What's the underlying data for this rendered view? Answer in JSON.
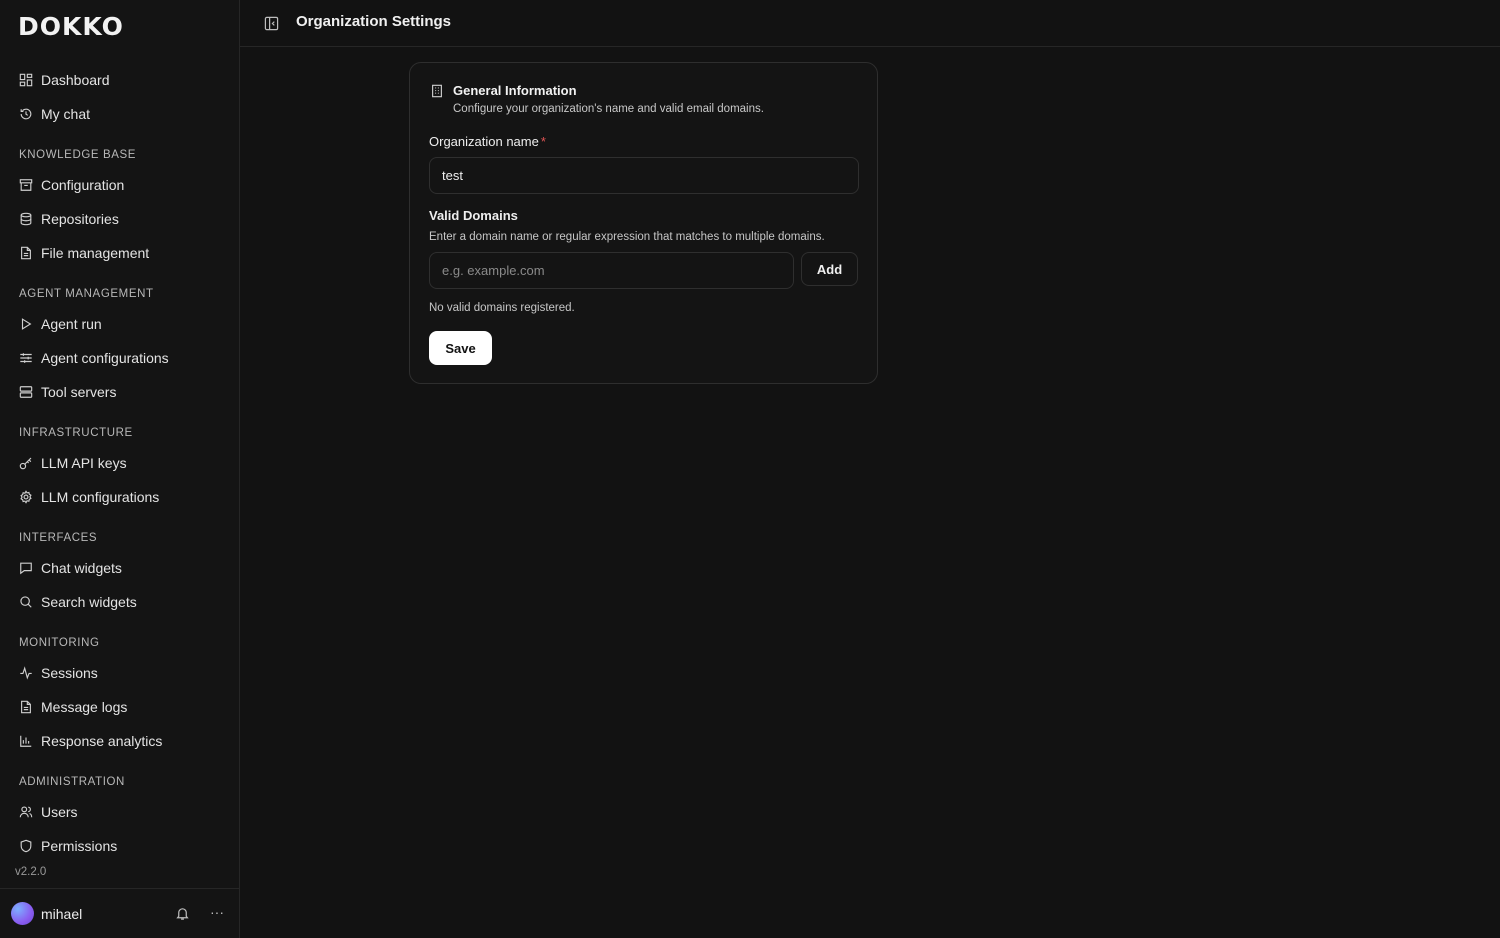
{
  "app": {
    "logo": "DOKKO",
    "version": "v2.2.0"
  },
  "sidebar": {
    "top_items": [
      {
        "label": "Dashboard",
        "icon": "dashboard-icon"
      },
      {
        "label": "My chat",
        "icon": "history-icon"
      }
    ],
    "sections": [
      {
        "title": "KNOWLEDGE BASE",
        "items": [
          {
            "label": "Configuration",
            "icon": "archive-icon"
          },
          {
            "label": "Repositories",
            "icon": "database-icon"
          },
          {
            "label": "File management",
            "icon": "file-icon"
          }
        ]
      },
      {
        "title": "AGENT MANAGEMENT",
        "items": [
          {
            "label": "Agent run",
            "icon": "play-icon"
          },
          {
            "label": "Agent configurations",
            "icon": "sliders-icon"
          },
          {
            "label": "Tool servers",
            "icon": "server-icon"
          }
        ]
      },
      {
        "title": "INFRASTRUCTURE",
        "items": [
          {
            "label": "LLM API keys",
            "icon": "key-icon"
          },
          {
            "label": "LLM configurations",
            "icon": "gear-icon"
          }
        ]
      },
      {
        "title": "INTERFACES",
        "items": [
          {
            "label": "Chat widgets",
            "icon": "chat-icon"
          },
          {
            "label": "Search widgets",
            "icon": "search-icon"
          }
        ]
      },
      {
        "title": "MONITORING",
        "items": [
          {
            "label": "Sessions",
            "icon": "activity-icon"
          },
          {
            "label": "Message logs",
            "icon": "file-icon"
          },
          {
            "label": "Response analytics",
            "icon": "bar-chart-icon"
          }
        ]
      },
      {
        "title": "ADMINISTRATION",
        "items": [
          {
            "label": "Users",
            "icon": "users-icon"
          },
          {
            "label": "Permissions",
            "icon": "shield-icon"
          }
        ]
      }
    ],
    "user": {
      "name": "mihael"
    }
  },
  "header": {
    "title": "Organization Settings"
  },
  "card": {
    "title": "General Information",
    "description": "Configure your organization's name and valid email domains.",
    "org_name_label": "Organization name",
    "org_name_required": "*",
    "org_name_value": "test",
    "domains_label": "Valid Domains",
    "domains_hint": "Enter a domain name or regular expression that matches to multiple domains.",
    "domain_placeholder": "e.g. example.com",
    "add_label": "Add",
    "empty_text": "No valid domains registered.",
    "save_label": "Save"
  }
}
